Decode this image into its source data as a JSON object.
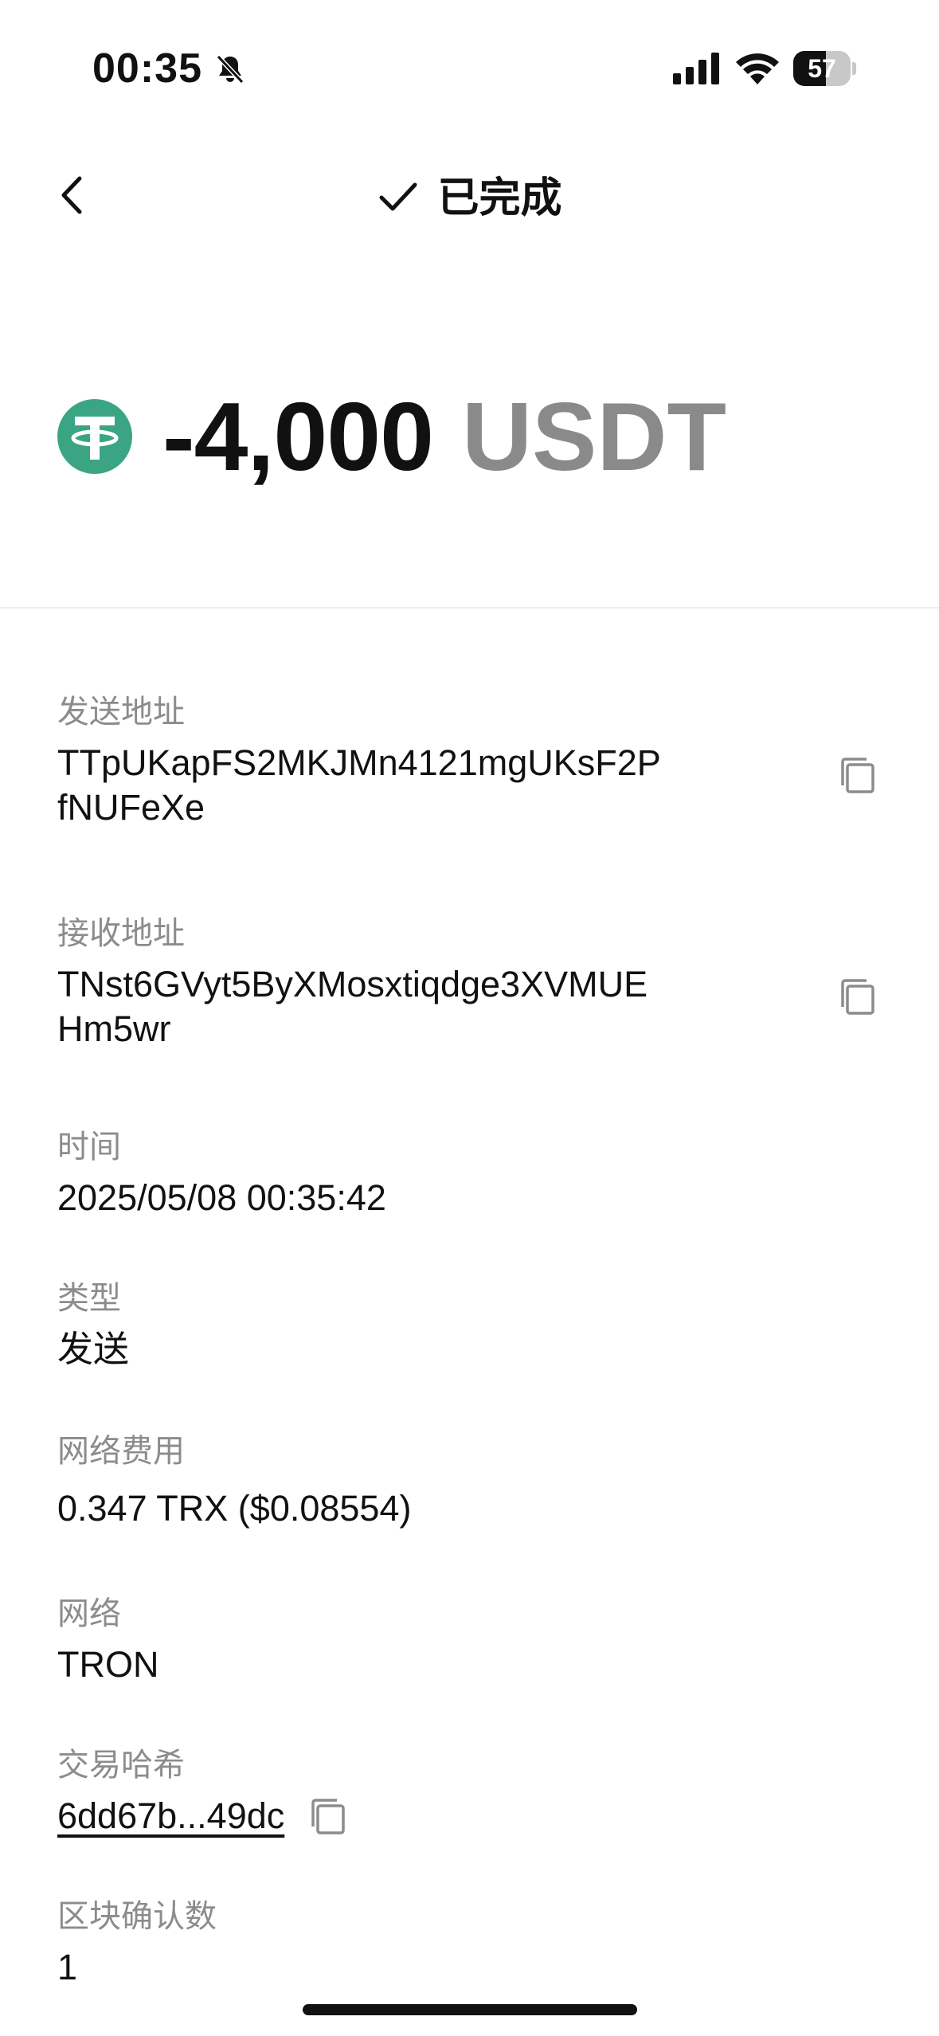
{
  "status_bar": {
    "time": "00:35",
    "battery": "57",
    "battery_level": 0.57
  },
  "header": {
    "title": "已完成"
  },
  "amount": {
    "value": "-4,000",
    "symbol": "USDT",
    "token_color": "#3BA583"
  },
  "details": {
    "from": {
      "label": "发送地址",
      "value": "TTpUKapFS2MKJMn4121mgUKsF2PfNUFeXe"
    },
    "to": {
      "label": "接收地址",
      "value": "TNst6GVyt5ByXMosxtiqdge3XVMUEHm5wr"
    },
    "time": {
      "label": "时间",
      "value": "2025/05/08 00:35:42"
    },
    "type": {
      "label": "类型",
      "value": "发送"
    },
    "fee": {
      "label": "网络费用",
      "value": "0.347 TRX ($0.08554)"
    },
    "network": {
      "label": "网络",
      "value": "TRON"
    },
    "hash": {
      "label": "交易哈希",
      "value": "6dd67b...49dc"
    },
    "confirmations": {
      "label": "区块确认数",
      "value": "1"
    }
  },
  "icons": {
    "back": "chevron-left-icon",
    "done": "check-icon",
    "copy": "copy-icon",
    "token": "tether-icon"
  }
}
